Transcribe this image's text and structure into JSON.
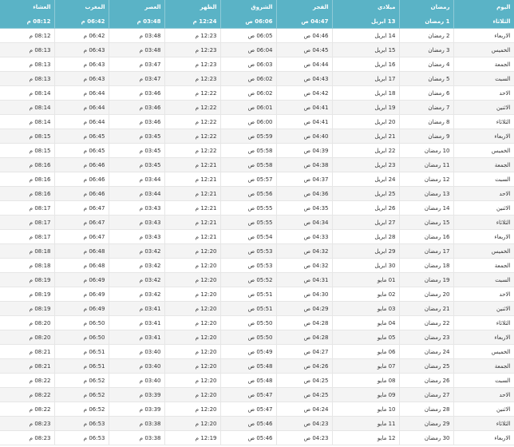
{
  "headers": [
    "اليوم",
    "رمضان",
    "ميلادي",
    "الفجر",
    "الشروق",
    "الظهر",
    "العصر",
    "المغرب",
    "العشاء"
  ],
  "rows": [
    [
      "الثلاثاء",
      "1 رمضان",
      "13 ابريل",
      "04:47 ص",
      "06:06 ص",
      "12:24 م",
      "03:48 م",
      "06:42 م",
      "08:12 م"
    ],
    [
      "الاربعاء",
      "2 رمضان",
      "14 ابريل",
      "04:46 ص",
      "06:05 ص",
      "12:23 م",
      "03:48 م",
      "06:42 م",
      "08:12 م"
    ],
    [
      "الخميس",
      "3 رمضان",
      "15 ابريل",
      "04:45 ص",
      "06:04 ص",
      "12:23 م",
      "03:48 م",
      "06:43 م",
      "08:13 م"
    ],
    [
      "الجمعة",
      "4 رمضان",
      "16 ابريل",
      "04:44 ص",
      "06:03 ص",
      "12:23 م",
      "03:47 م",
      "06:43 م",
      "08:13 م"
    ],
    [
      "السبت",
      "5 رمضان",
      "17 ابريل",
      "04:43 ص",
      "06:02 ص",
      "12:23 م",
      "03:47 م",
      "06:43 م",
      "08:13 م"
    ],
    [
      "الاحد",
      "6 رمضان",
      "18 ابريل",
      "04:42 ص",
      "06:02 ص",
      "12:22 م",
      "03:46 م",
      "06:44 م",
      "08:14 م"
    ],
    [
      "الاثنين",
      "7 رمضان",
      "19 ابريل",
      "04:41 ص",
      "06:01 ص",
      "12:22 م",
      "03:46 م",
      "06:44 م",
      "08:14 م"
    ],
    [
      "الثلاثاء",
      "8 رمضان",
      "20 ابريل",
      "04:41 ص",
      "06:00 ص",
      "12:22 م",
      "03:46 م",
      "06:44 م",
      "08:14 م"
    ],
    [
      "الاربعاء",
      "9 رمضان",
      "21 ابريل",
      "04:40 ص",
      "05:59 ص",
      "12:22 م",
      "03:45 م",
      "06:45 م",
      "08:15 م"
    ],
    [
      "الخميس",
      "10 رمضان",
      "22 ابريل",
      "04:39 ص",
      "05:58 ص",
      "12:22 م",
      "03:45 م",
      "06:45 م",
      "08:15 م"
    ],
    [
      "الجمعة",
      "11 رمضان",
      "23 ابريل",
      "04:38 ص",
      "05:58 ص",
      "12:21 م",
      "03:45 م",
      "06:46 م",
      "08:16 م"
    ],
    [
      "السبت",
      "12 رمضان",
      "24 ابريل",
      "04:37 ص",
      "05:57 ص",
      "12:21 م",
      "03:44 م",
      "06:46 م",
      "08:16 م"
    ],
    [
      "الاحد",
      "13 رمضان",
      "25 ابريل",
      "04:36 ص",
      "05:56 ص",
      "12:21 م",
      "03:44 م",
      "06:46 م",
      "08:16 م"
    ],
    [
      "الاثنين",
      "14 رمضان",
      "26 ابريل",
      "04:35 ص",
      "05:55 ص",
      "12:21 م",
      "03:43 م",
      "06:47 م",
      "08:17 م"
    ],
    [
      "الثلاثاء",
      "15 رمضان",
      "27 ابريل",
      "04:34 ص",
      "05:55 ص",
      "12:21 م",
      "03:43 م",
      "06:47 م",
      "08:17 م"
    ],
    [
      "الاربعاء",
      "16 رمضان",
      "28 ابريل",
      "04:33 ص",
      "05:54 ص",
      "12:21 م",
      "03:43 م",
      "06:47 م",
      "08:17 م"
    ],
    [
      "الخميس",
      "17 رمضان",
      "29 ابريل",
      "04:32 ص",
      "05:53 ص",
      "12:20 م",
      "03:42 م",
      "06:48 م",
      "08:18 م"
    ],
    [
      "الجمعة",
      "18 رمضان",
      "30 ابريل",
      "04:32 ص",
      "05:53 ص",
      "12:20 م",
      "03:42 م",
      "06:48 م",
      "08:18 م"
    ],
    [
      "السبت",
      "19 رمضان",
      "01 مايو",
      "04:31 ص",
      "05:52 ص",
      "12:20 م",
      "03:42 م",
      "06:49 م",
      "08:19 م"
    ],
    [
      "الاحد",
      "20 رمضان",
      "02 مايو",
      "04:30 ص",
      "05:51 ص",
      "12:20 م",
      "03:42 م",
      "06:49 م",
      "08:19 م"
    ],
    [
      "الاثنين",
      "21 رمضان",
      "03 مايو",
      "04:29 ص",
      "05:51 ص",
      "12:20 م",
      "03:41 م",
      "06:49 م",
      "08:19 م"
    ],
    [
      "الثلاثاء",
      "22 رمضان",
      "04 مايو",
      "04:28 ص",
      "05:50 ص",
      "12:20 م",
      "03:41 م",
      "06:50 م",
      "08:20 م"
    ],
    [
      "الاربعاء",
      "23 رمضان",
      "05 مايو",
      "04:28 ص",
      "05:50 ص",
      "12:20 م",
      "03:41 م",
      "06:50 م",
      "08:20 م"
    ],
    [
      "الخميس",
      "24 رمضان",
      "06 مايو",
      "04:27 ص",
      "05:49 ص",
      "12:20 م",
      "03:40 م",
      "06:51 م",
      "08:21 م"
    ],
    [
      "الجمعة",
      "25 رمضان",
      "07 مايو",
      "04:26 ص",
      "05:48 ص",
      "12:20 م",
      "03:40 م",
      "06:51 م",
      "08:21 م"
    ],
    [
      "السبت",
      "26 رمضان",
      "08 مايو",
      "04:25 ص",
      "05:48 ص",
      "12:20 م",
      "03:40 م",
      "06:52 م",
      "08:22 م"
    ],
    [
      "الاحد",
      "27 رمضان",
      "09 مايو",
      "04:25 ص",
      "05:47 ص",
      "12:20 م",
      "03:39 م",
      "06:52 م",
      "08:22 م"
    ],
    [
      "الاثنين",
      "28 رمضان",
      "10 مايو",
      "04:24 ص",
      "05:47 ص",
      "12:20 م",
      "03:39 م",
      "06:52 م",
      "08:22 م"
    ],
    [
      "الثلاثاء",
      "29 رمضان",
      "11 مايو",
      "04:23 ص",
      "05:46 ص",
      "12:20 م",
      "03:38 م",
      "06:53 م",
      "08:23 م"
    ],
    [
      "الاربعاء",
      "30 رمضان",
      "12 مايو",
      "04:23 ص",
      "05:46 ص",
      "12:19 م",
      "03:38 م",
      "06:53 م",
      "08:23 م"
    ]
  ],
  "colors": {
    "header_bg": "#5ab3c6",
    "highlight_row_bg": "#5ab3c6",
    "stripe_bg": "#f4f4f4"
  }
}
